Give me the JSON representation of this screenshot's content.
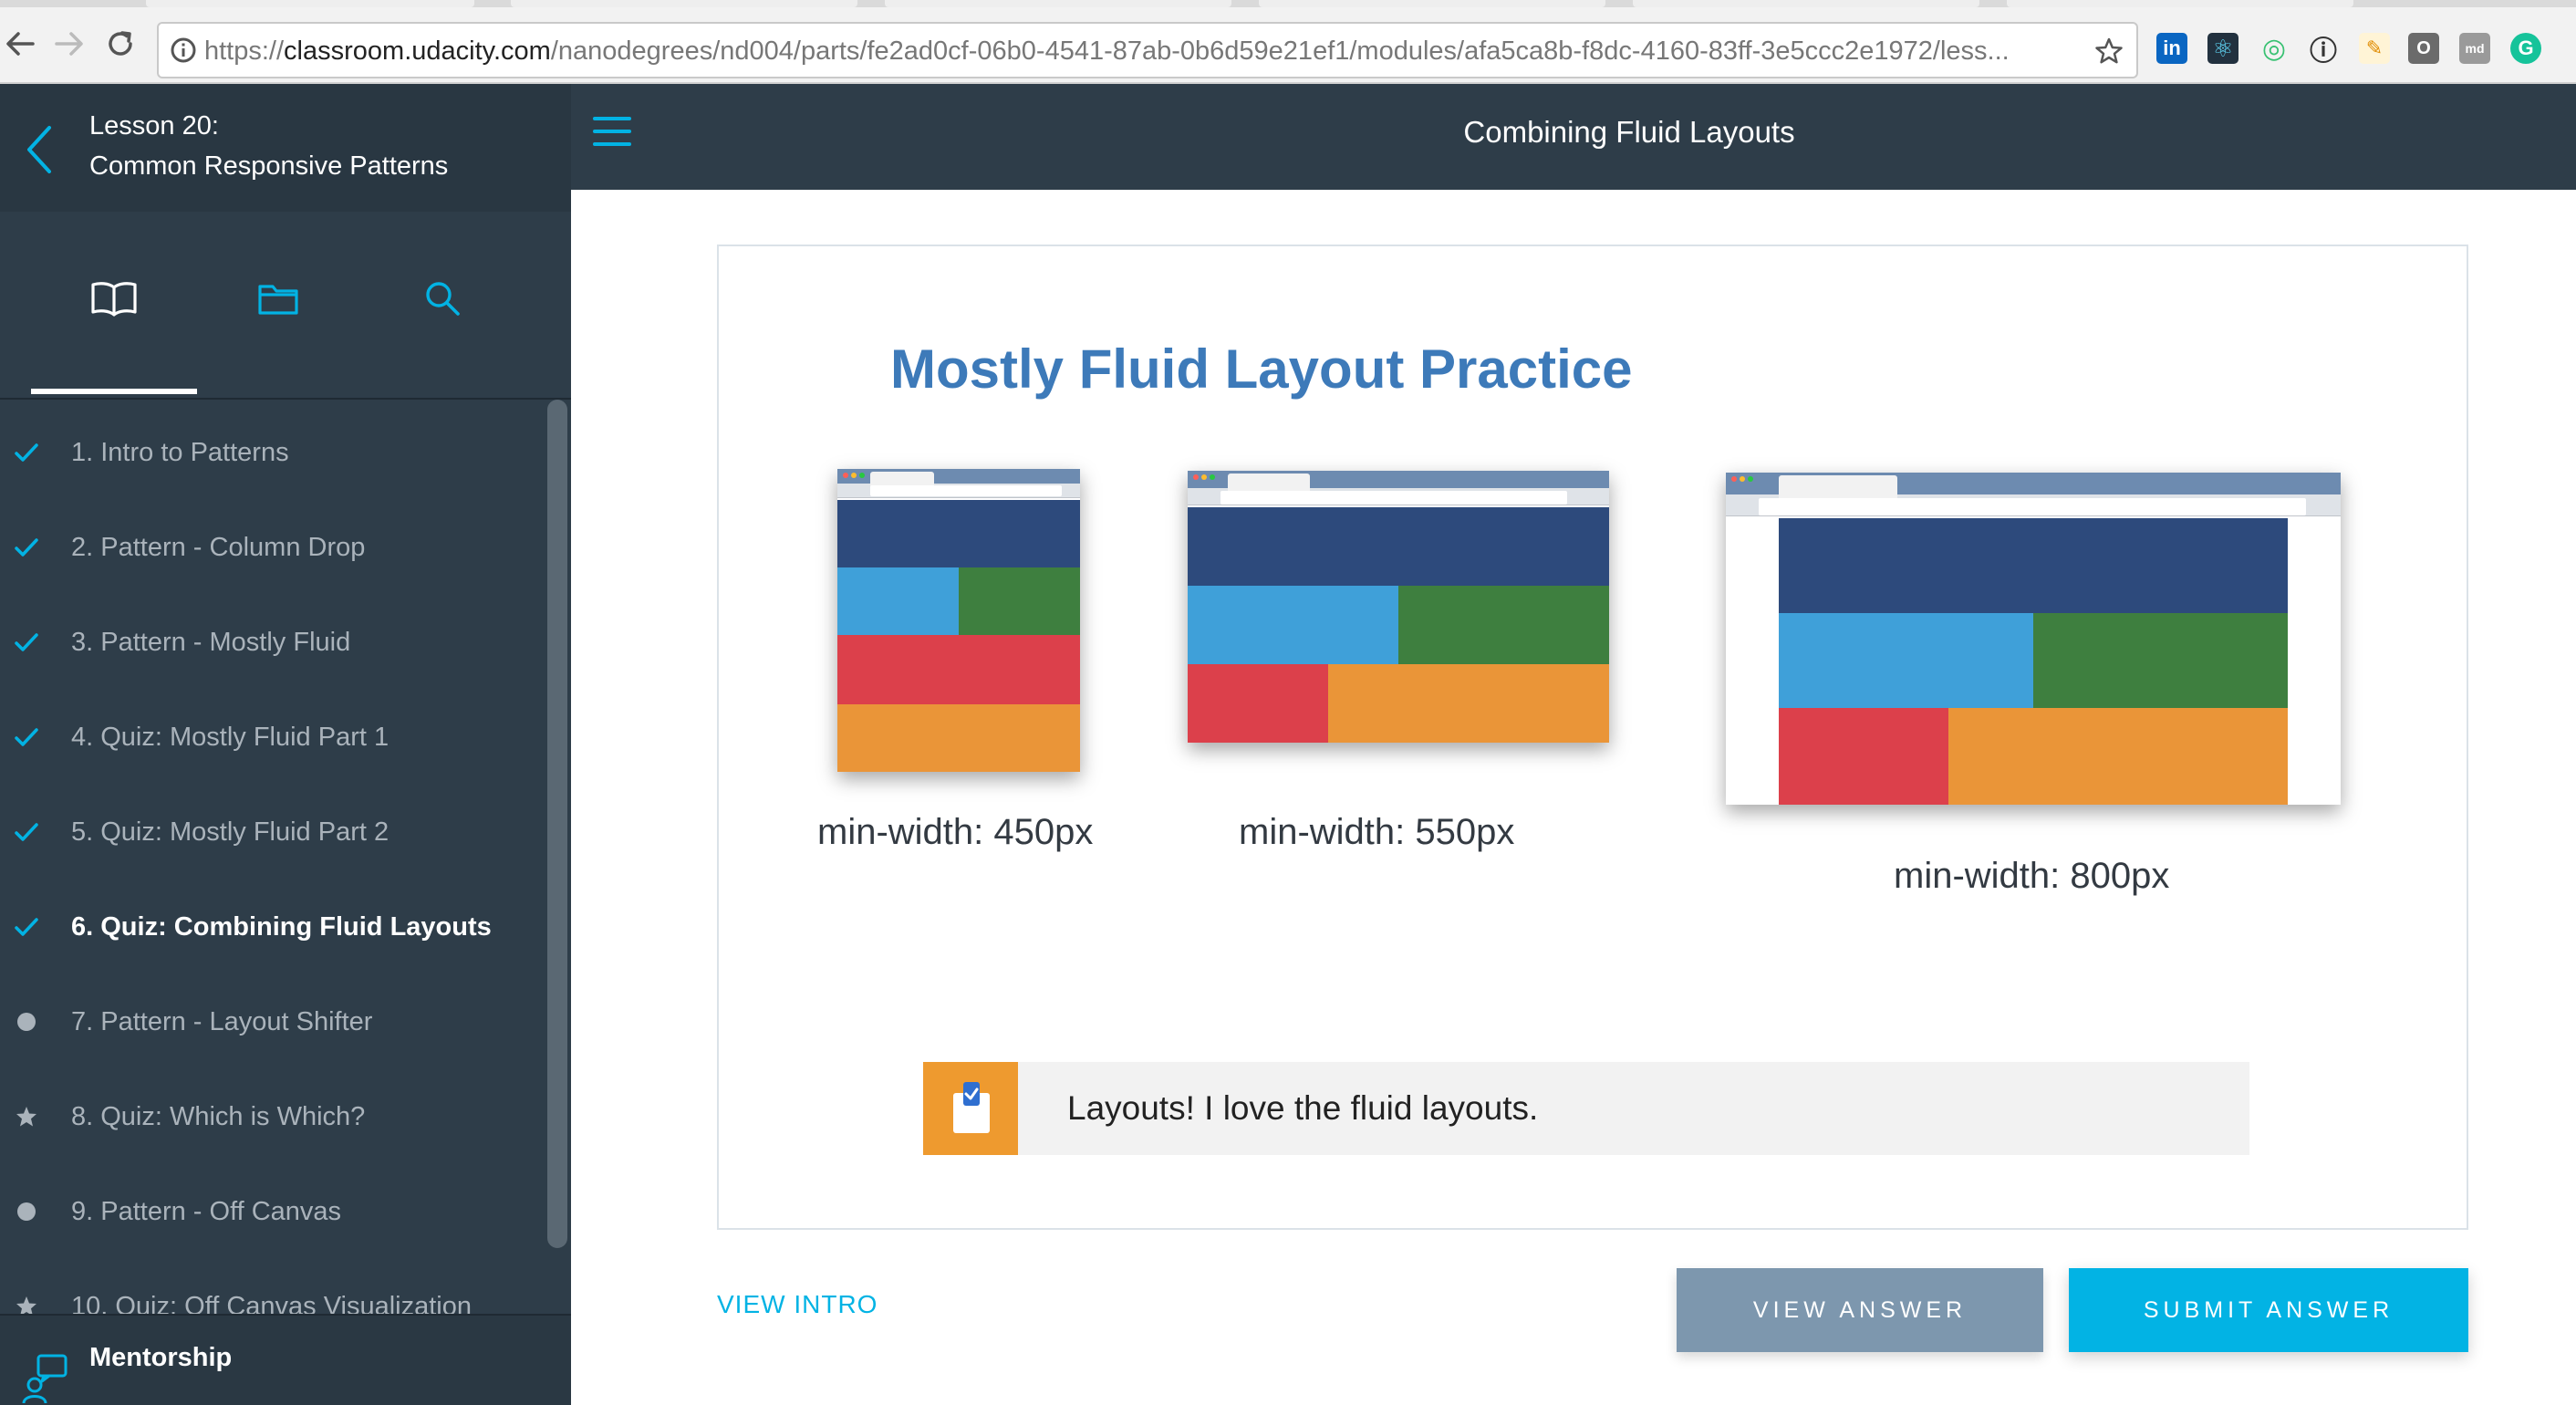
{
  "browser": {
    "url_prefix": "https://",
    "url_host": "classroom.udacity.com",
    "url_path": "/nanodegrees/nd004/parts/fe2ad0cf-06b0-4541-87ab-0b6d59e21ef1/modules/afa5ca8b-f8dc-4160-83ff-3e5ccc2e1972/less...",
    "extensions": [
      "in",
      "⚛",
      "◎",
      "ⓘ",
      "✎",
      "O",
      "md",
      "G"
    ]
  },
  "sidebar": {
    "lesson_number": "Lesson 20:",
    "lesson_name": "Common Responsive Patterns",
    "tabs": [
      {
        "icon": "book-icon",
        "active": true
      },
      {
        "icon": "folder-icon",
        "active": false
      },
      {
        "icon": "search-icon",
        "active": false
      }
    ],
    "concepts": [
      {
        "label": "1. Intro to Patterns",
        "status": "done"
      },
      {
        "label": "2. Pattern - Column Drop",
        "status": "done"
      },
      {
        "label": "3. Pattern - Mostly Fluid",
        "status": "done"
      },
      {
        "label": "4. Quiz: Mostly Fluid Part 1",
        "status": "done"
      },
      {
        "label": "5. Quiz: Mostly Fluid Part 2",
        "status": "done"
      },
      {
        "label": "6. Quiz: Combining Fluid Layouts",
        "status": "current"
      },
      {
        "label": "7. Pattern - Layout Shifter",
        "status": "dot"
      },
      {
        "label": "8. Quiz: Which is Which?",
        "status": "star"
      },
      {
        "label": "9. Pattern - Off Canvas",
        "status": "dot"
      },
      {
        "label": "10. Quiz: Off Canvas Visualization",
        "status": "star"
      }
    ],
    "mentorship_label": "Mentorship"
  },
  "header": {
    "title": "Combining Fluid Layouts"
  },
  "quiz": {
    "heading": "Mostly Fluid Layout Practice",
    "screenshots": [
      {
        "caption": "min-width: 450px"
      },
      {
        "caption": "min-width: 550px"
      },
      {
        "caption": "min-width: 800px"
      }
    ],
    "answer_text": "Layouts! I love the fluid layouts."
  },
  "actions": {
    "view_intro": "VIEW INTRO",
    "view_answer": "VIEW ANSWER",
    "submit_answer": "SUBMIT ANSWER"
  },
  "colors": {
    "accent": "#02b3e4",
    "sidebar_bg": "#2e3d49",
    "heading_blue": "#3d7ab9",
    "navy": "#2d4a7c",
    "blue": "#3fa0d9",
    "green": "#3e7f3f",
    "red": "#dc404b",
    "orange": "#ea9538"
  }
}
